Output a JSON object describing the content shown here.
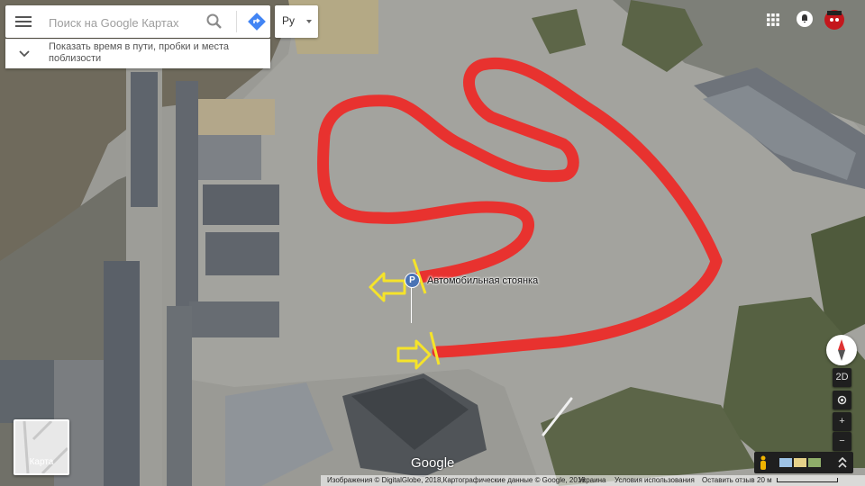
{
  "search": {
    "placeholder": "Поиск на Google Картах"
  },
  "suggestion": {
    "text": "Показать время в пути, пробки и места поблизости"
  },
  "language": {
    "label": "Ру"
  },
  "poi": {
    "pin_letter": "P",
    "label": "Автомобильная стоянка"
  },
  "layers": {
    "label": "Карта"
  },
  "controls": {
    "mode_2d": "2D",
    "zoom_in": "+",
    "zoom_out": "−"
  },
  "logo": {
    "text": "Google"
  },
  "footer": {
    "imagery": "Изображения © DigitalGlobe, 2018,Картографические данные © Google, 2018",
    "country": "Украина",
    "terms": "Условия использования",
    "feedback": "Оставить отзыв",
    "scale": "20 м"
  },
  "icons": {
    "menu": "menu-icon",
    "search": "search-icon",
    "directions": "directions-icon",
    "chevron": "chevron-down-icon",
    "apps": "apps-grid-icon",
    "notifications": "notifications-icon",
    "avatar": "user-avatar-icon",
    "compass": "compass-icon",
    "locate": "my-location-icon",
    "pegman": "pegman-icon",
    "expand": "expand-icon"
  },
  "colors": {
    "route": "#e8322f",
    "arrow": "#f5e32a",
    "pin": "#4a73b5"
  }
}
